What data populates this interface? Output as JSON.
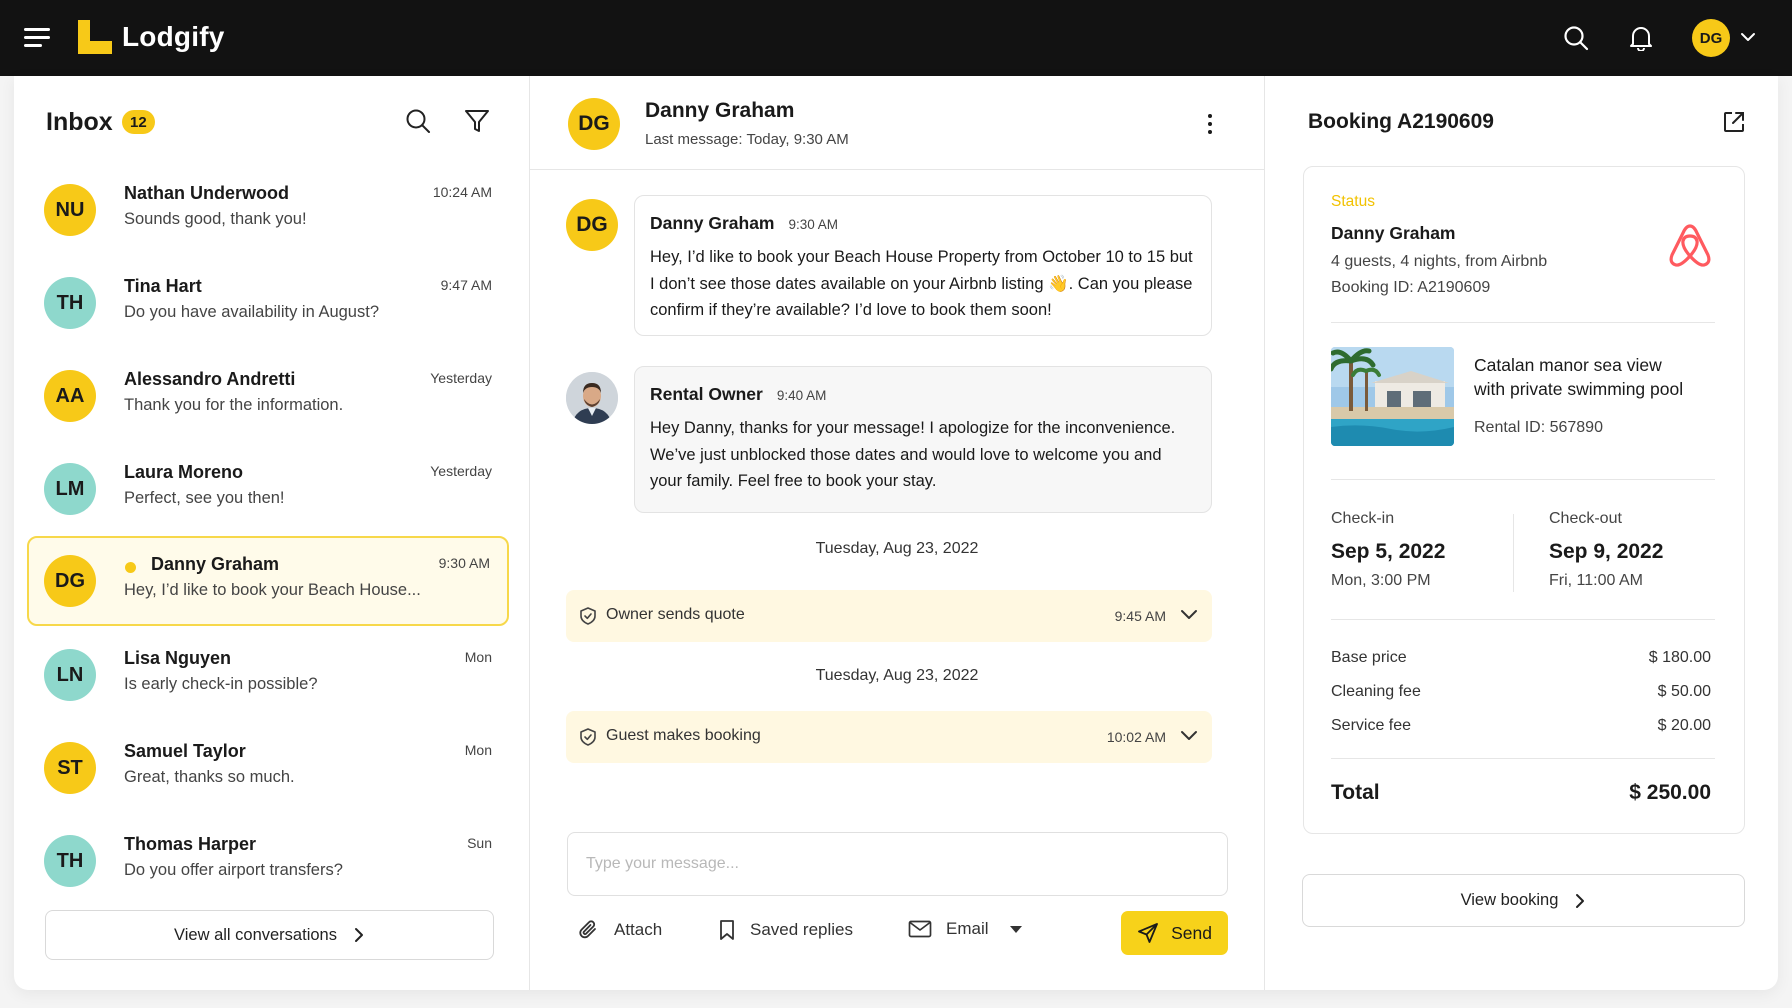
{
  "app": {
    "brand": "Lodgify",
    "user_initials": "DG",
    "accent_color": "#f7c918"
  },
  "inbox": {
    "title": "Inbox",
    "unread_count": "12",
    "view_all_label": "View all conversations",
    "conversations": [
      {
        "initials": "NU",
        "name": "Nathan Underwood",
        "preview": "Sounds good, thank you!",
        "time": "10:24 AM",
        "color": "#f7c918",
        "active": false
      },
      {
        "initials": "TH",
        "name": "Tina Hart",
        "preview": "Do you have availability in August?",
        "time": "9:47 AM",
        "color": "#8ed8cc",
        "active": false
      },
      {
        "initials": "AA",
        "name": "Alessandro Andretti",
        "preview": "Thank you for the information.",
        "time": "Yesterday",
        "color": "#f7c918",
        "active": false
      },
      {
        "initials": "LM",
        "name": "Laura Moreno",
        "preview": "Perfect, see you then!",
        "time": "Yesterday",
        "color": "#8ed8cc",
        "active": false
      },
      {
        "initials": "DG",
        "name": "Danny Graham",
        "preview": "Hey, I’d like to book your Beach House...",
        "time": "9:30 AM",
        "color": "#f7c918",
        "active": true
      },
      {
        "initials": "LN",
        "name": "Lisa Nguyen",
        "preview": "Is early check-in possible?",
        "time": "Mon",
        "color": "#8ed8cc",
        "active": false
      },
      {
        "initials": "ST",
        "name": "Samuel Taylor",
        "preview": "Great, thanks so much.",
        "time": "Mon",
        "color": "#f7c918",
        "active": false
      },
      {
        "initials": "TH",
        "name": "Thomas Harper",
        "preview": "Do you offer airport transfers?",
        "time": "Sun",
        "color": "#8ed8cc",
        "active": false
      }
    ]
  },
  "chat": {
    "contact_initials": "DG",
    "contact_name": "Danny Graham",
    "last_message": "Last message: Today, 9:30 AM",
    "messages": [
      {
        "sender": "Danny Graham",
        "time": "9:30 AM",
        "text": "Hey, I’d like to book your Beach House Property from October 10 to 15 but I don’t see those dates available on your Airbnb listing 👋. Can you please confirm if they’re available? I’d love to book them soon!"
      },
      {
        "sender": "Rental Owner",
        "time": "9:40 AM",
        "text": "Hey Danny, thanks for your message! I apologize for the inconvenience. We’ve just unblocked those dates and would love to welcome you and your family. Feel free to book your stay."
      }
    ],
    "events": [
      {
        "date": "Tuesday, Aug 23, 2022",
        "label": "Owner sends quote",
        "time": "9:45 AM"
      },
      {
        "date": "Tuesday, Aug 23, 2022",
        "label": "Guest makes booking",
        "time": "10:02 AM"
      }
    ],
    "composer": {
      "placeholder": "Type your message...",
      "attach_label": "Attach",
      "saved_replies_label": "Saved replies",
      "channel_label": "Email",
      "send_label": "Send"
    }
  },
  "booking": {
    "title": "Booking A2190609",
    "status_label": "Status",
    "guest_name": "Danny Graham",
    "guest_summary": "4 guests, 4 nights, from Airbnb",
    "booking_id": "Booking ID: A2190609",
    "property_name_line1": "Catalan manor sea view",
    "property_name_line2": "with private swimming pool",
    "rental_id": "Rental ID: 567890",
    "checkin_label": "Check-in",
    "checkin_date": "Sep 5, 2022",
    "checkin_time": "Mon, 3:00 PM",
    "checkout_label": "Check-out",
    "checkout_date": "Sep 9, 2022",
    "checkout_time": "Fri, 11:00 AM",
    "fees": [
      {
        "label": "Base price",
        "amount": "$ 180.00"
      },
      {
        "label": "Cleaning fee",
        "amount": "$ 50.00"
      },
      {
        "label": "Service fee",
        "amount": "$ 20.00"
      }
    ],
    "total_label": "Total",
    "total_amount": "$ 250.00",
    "view_booking_label": "View booking",
    "airbnb_color": "#ff5a5f",
    "status_color": "#f2c200"
  }
}
